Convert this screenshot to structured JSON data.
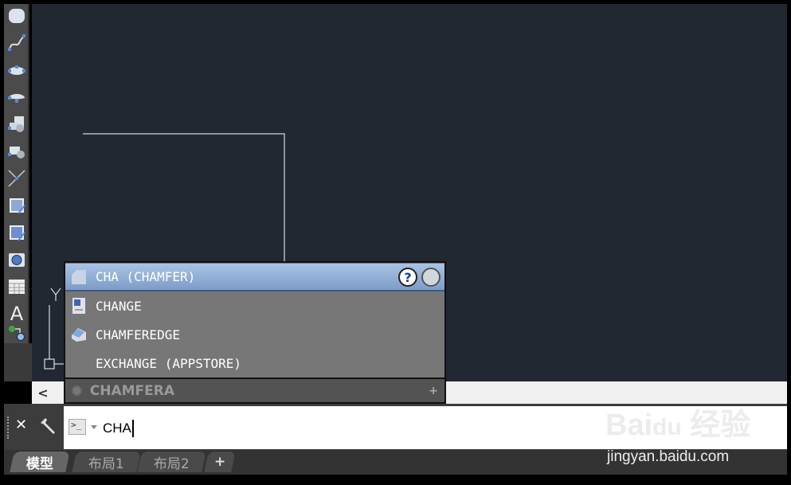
{
  "toolbar": {
    "icons": [
      "revision-cloud-icon",
      "spline-icon",
      "ellipse-icon",
      "ellipse-arc-icon",
      "insert-block-icon",
      "make-block-icon",
      "point-icon",
      "hatch-icon",
      "gradient-icon",
      "region-icon",
      "table-icon",
      "multiline-text-icon",
      "add-selected-icon"
    ]
  },
  "autocomplete": {
    "items": [
      {
        "label": "CHA (CHAMFER)",
        "icon": "chamfer-icon"
      },
      {
        "label": "CHANGE",
        "icon": "change-icon"
      },
      {
        "label": "CHAMFEREDGE",
        "icon": "chamferedge-icon"
      },
      {
        "label": "EXCHANGE (APPSTORE)",
        "icon": ""
      }
    ],
    "footer": "CHAMFERA",
    "footer_plus": "+"
  },
  "scrollbar": {
    "left": "<"
  },
  "command": {
    "close": "✕",
    "value": "CHA"
  },
  "tabs": [
    "模型",
    "布局1",
    "布局2",
    "+"
  ],
  "watermark": {
    "logo": "Bai du 经验",
    "url": "jingyan.baidu.com"
  },
  "colors": {
    "canvas": "#222831",
    "highlight": "#8fabd6",
    "popup": "#777777"
  }
}
